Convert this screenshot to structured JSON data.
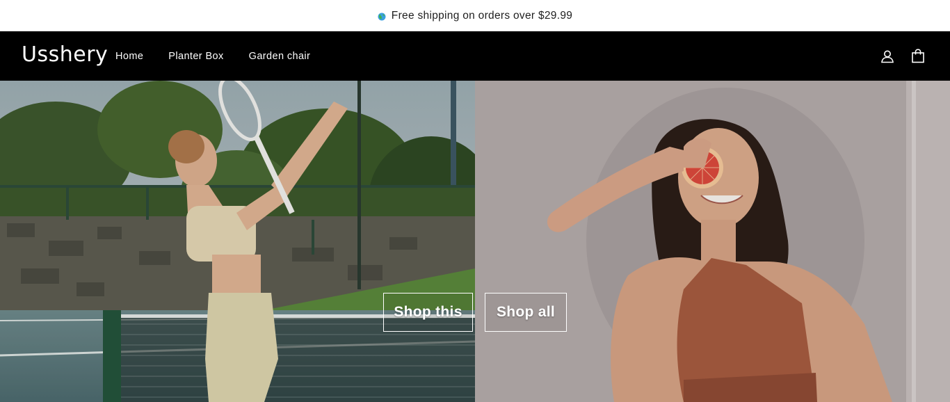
{
  "announcement": {
    "text": "Free shipping on orders over $29.99",
    "icon": "globe-icon"
  },
  "header": {
    "logo": "Usshery",
    "nav": [
      {
        "label": "Home"
      },
      {
        "label": "Planter Box"
      },
      {
        "label": "Garden chair"
      }
    ],
    "icons": [
      "account-icon",
      "cart-icon"
    ]
  },
  "hero": {
    "left_image": "woman playing tennis on court",
    "right_image": "woman holding grapefruit over eye",
    "buttons": {
      "shop_this": "Shop this",
      "shop_all": "Shop all"
    }
  },
  "colors": {
    "header_bg": "#000000",
    "announce_bg": "#ffffff",
    "text_light": "#ffffff"
  }
}
